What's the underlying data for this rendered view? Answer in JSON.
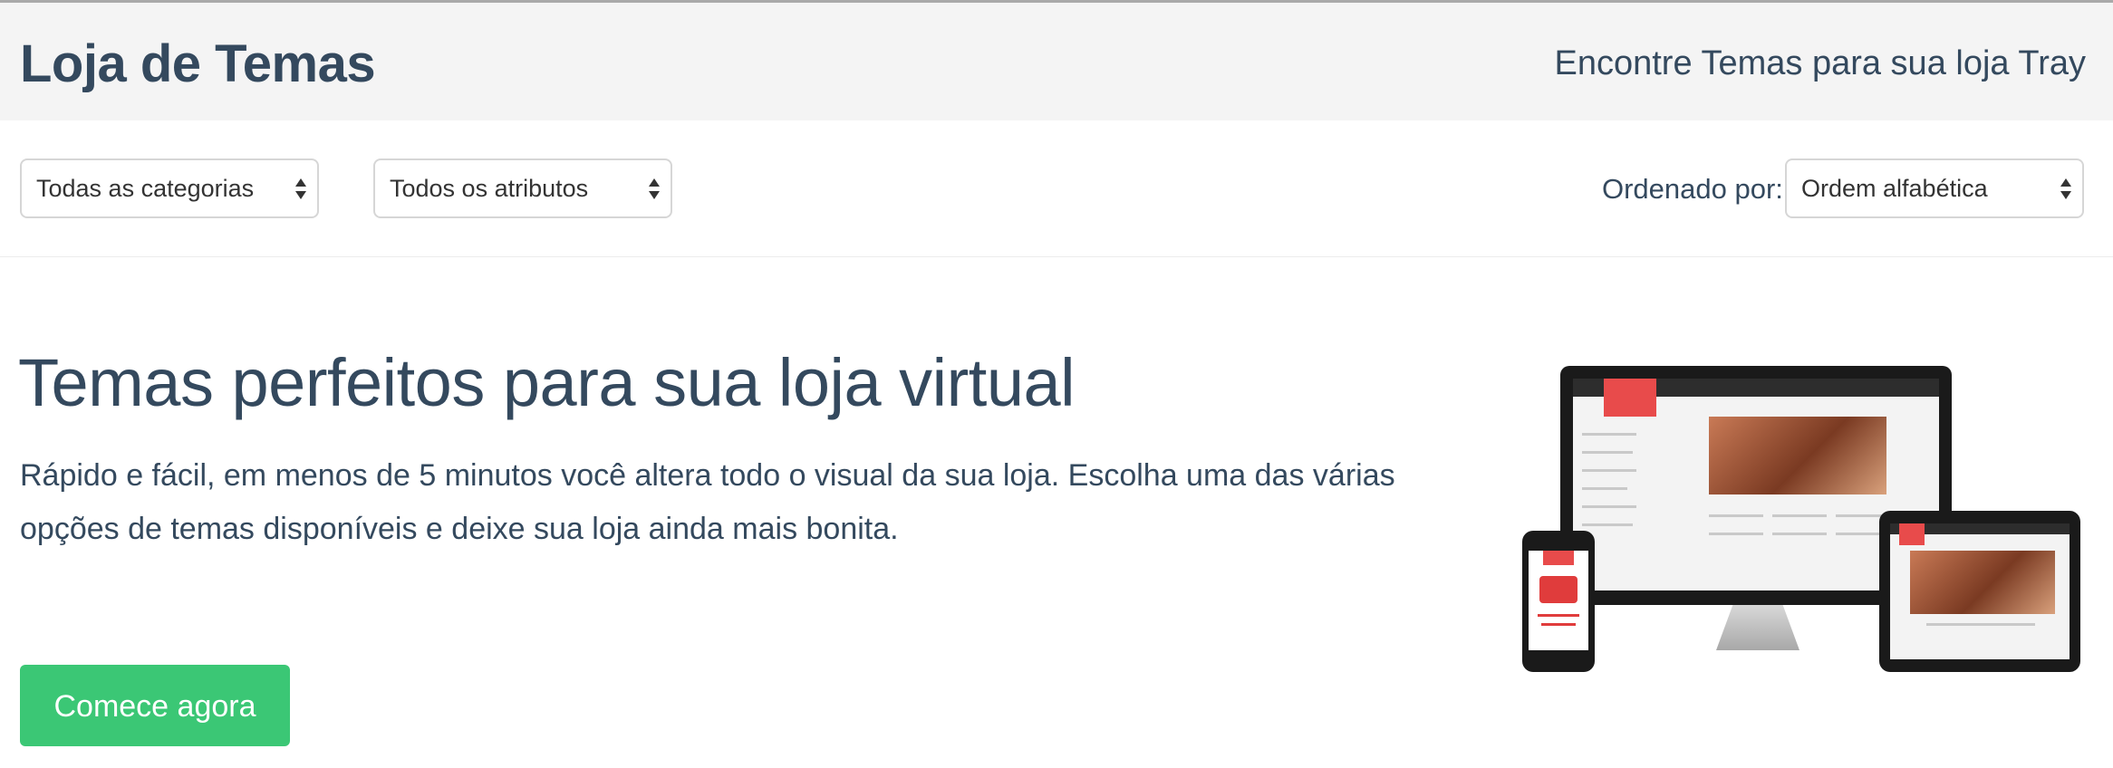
{
  "header": {
    "title": "Loja de Temas",
    "tagline": "Encontre Temas para sua loja Tray"
  },
  "filters": {
    "category_selected": "Todas as categorias",
    "attribute_selected": "Todos os atributos",
    "order_label": "Ordenado por:",
    "order_selected": "Ordem alfabética"
  },
  "hero": {
    "title": "Temas perfeitos para sua loja virtual",
    "description": "Rápido e fácil, em menos de 5 minutos você altera todo o visual da sua loja. Escolha uma das várias opções de temas disponíveis e deixe sua loja ainda mais bonita.",
    "cta_label": "Comece agora"
  },
  "colors": {
    "text": "#34495e",
    "header_bg": "#f4f4f4",
    "cta_bg": "#3bc775",
    "cta_text": "#ffffff"
  },
  "icons": {
    "select_caret": "chevron-up-down-icon"
  }
}
